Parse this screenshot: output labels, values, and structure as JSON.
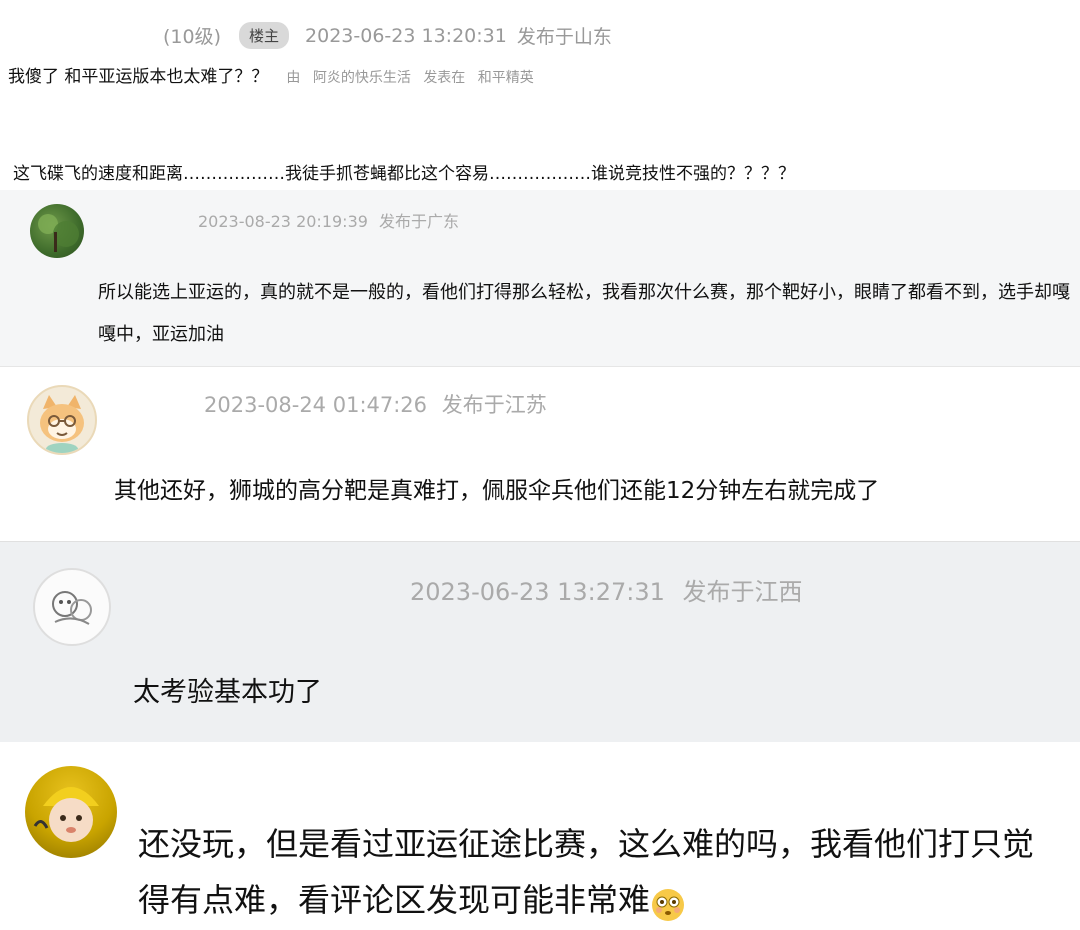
{
  "original_post": {
    "level": "(10级)",
    "badge": "楼主",
    "timestamp": "2023-06-23 13:20:31",
    "location": "发布于山东",
    "title": "我傻了 和平亚运版本也太难了？？",
    "by_prefix": "由",
    "author": "阿炎的快乐生活",
    "posted_in": "发表在",
    "forum": "和平精英",
    "body": "这飞碟飞的速度和距离………………我徒手抓苍蝇都比这个容易………………谁说竞技性不强的？？？？"
  },
  "replies": [
    {
      "timestamp": "2023-08-23 20:19:39",
      "location": "发布于广东",
      "text": "所以能选上亚运的，真的就不是一般的，看他们打得那么轻松，我看那次什么赛，那个靶好小，眼睛了都看不到，选手却嘎嘎中，亚运加油",
      "avatar_icon": "green-landscape-avatar-icon"
    },
    {
      "timestamp": "2023-08-24 01:47:26",
      "location": "发布于江苏",
      "text": "其他还好，狮城的高分靶是真难打，佩服伞兵他们还能12分钟左右就完成了",
      "avatar_icon": "cartoon-cat-avatar-icon"
    },
    {
      "timestamp": "2023-06-23 13:27:31",
      "location": "发布于江西",
      "text": "太考验基本功了",
      "avatar_icon": "sketch-avatar-icon"
    },
    {
      "text": "还没玩，但是看过亚运征途比赛，这么难的吗，我看他们打只觉得有点难，看评论区发现可能非常难",
      "emoji": "flushed-face-emoji",
      "avatar_icon": "child-yellow-hat-avatar-icon"
    }
  ],
  "colors": {
    "meta_gray": "#aaaaaa",
    "badge_bg": "#d9d9d9",
    "reply_bg_light": "#f5f6f7",
    "reply_bg_dark": "#eef0f2"
  }
}
